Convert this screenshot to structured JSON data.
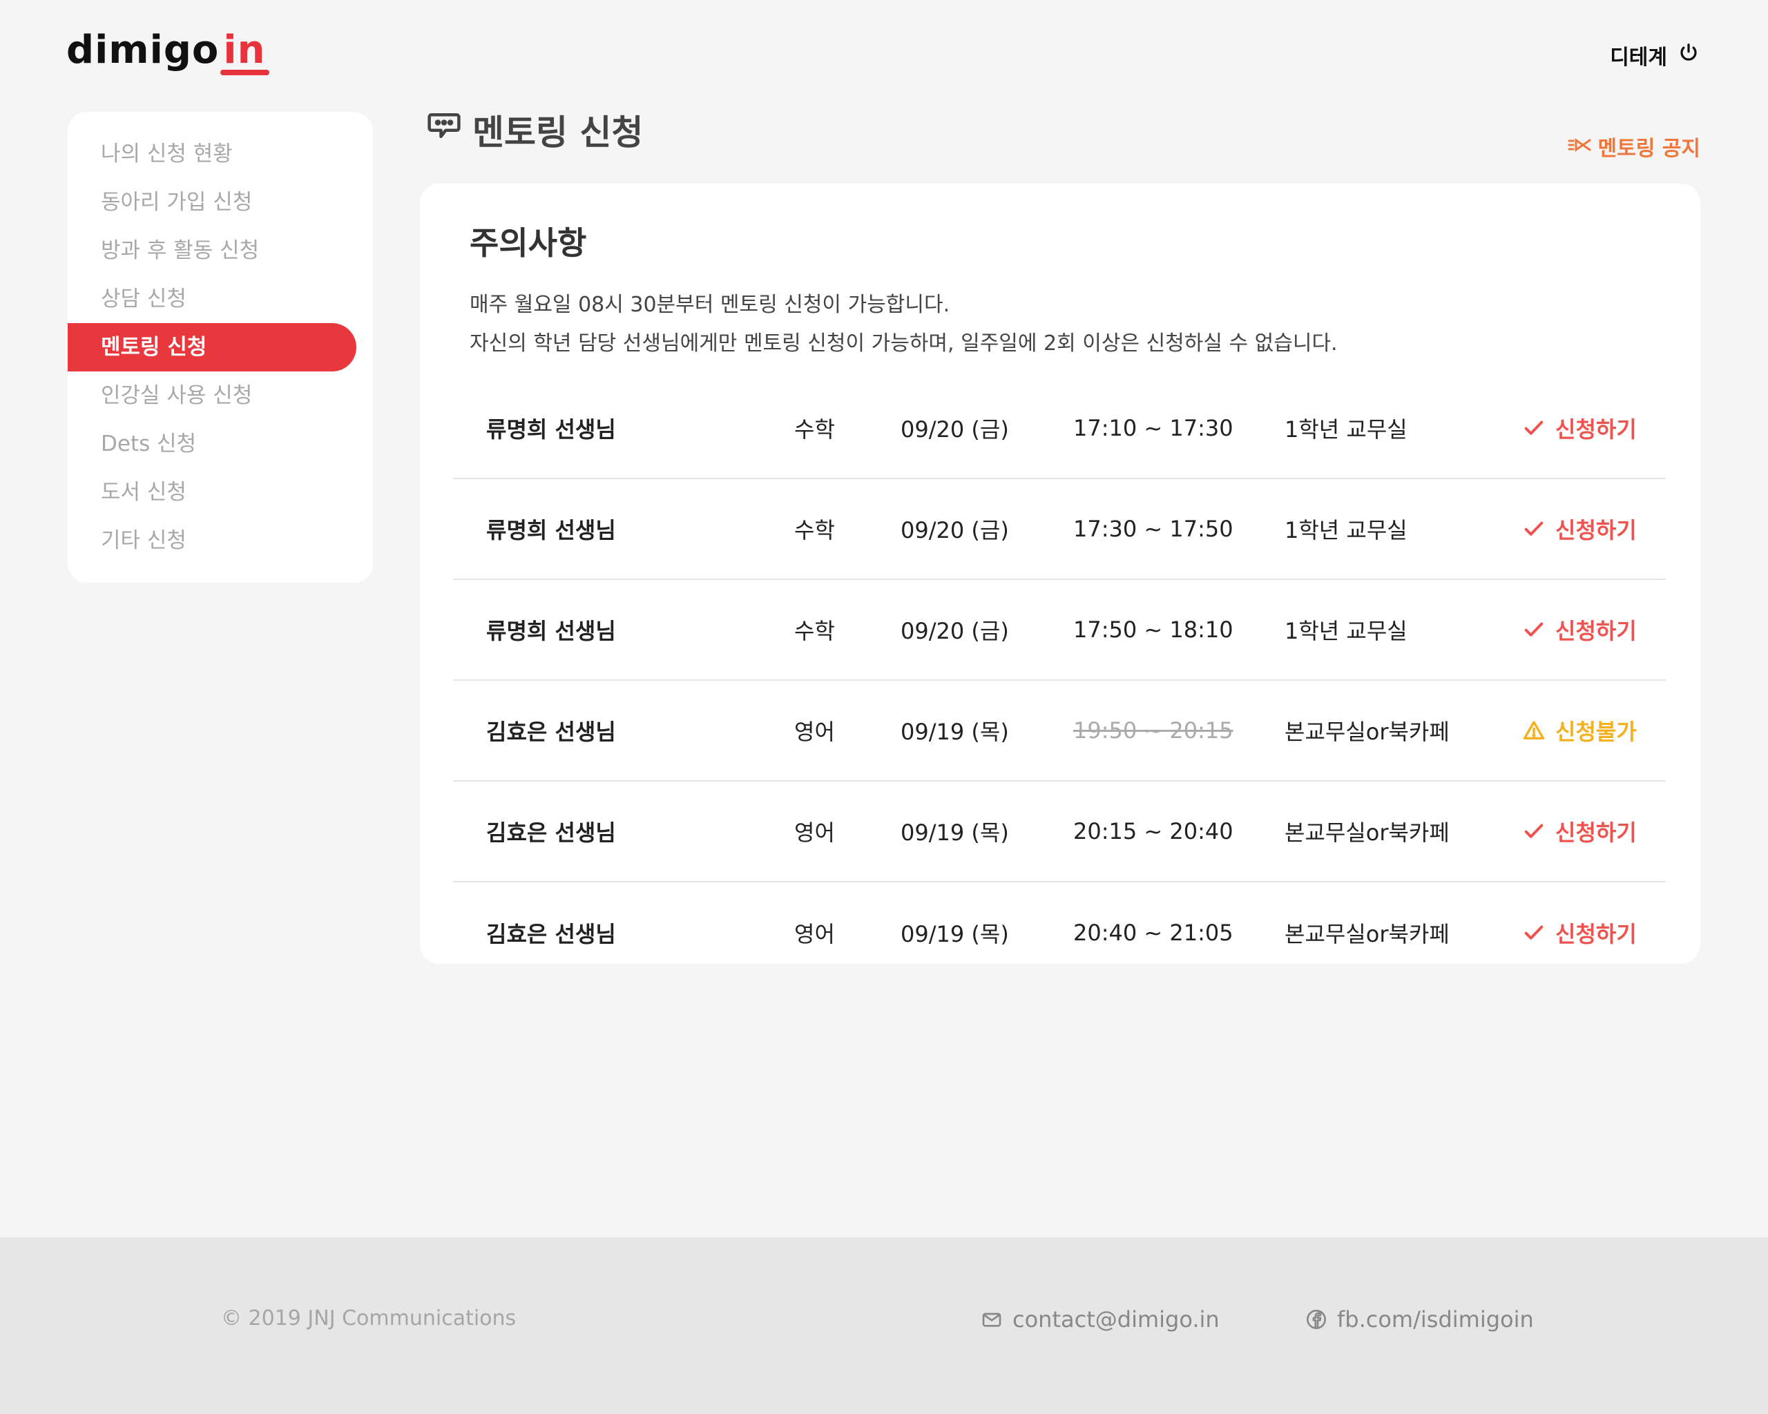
{
  "header": {
    "logo_main": "dimigo",
    "logo_accent": "in",
    "user_name": "디테계"
  },
  "sidebar": {
    "items": [
      {
        "label": "나의 신청 현황"
      },
      {
        "label": "동아리 가입 신청"
      },
      {
        "label": "방과 후 활동 신청"
      },
      {
        "label": "상담 신청"
      },
      {
        "label": "멘토링 신청",
        "active": true
      },
      {
        "label": "인강실 사용 신청"
      },
      {
        "label": "Dets 신청"
      },
      {
        "label": "도서 신청"
      },
      {
        "label": "기타 신청"
      }
    ]
  },
  "main": {
    "title": "멘토링 신청",
    "notice_link": "멘토링 공지",
    "card_title": "주의사항",
    "notes": [
      "매주 월요일 08시 30분부터 멘토링 신청이 가능합니다.",
      "자신의 학년 담당 선생님에게만 멘토링 신청이 가능하며, 일주일에 2회 이상은 신청하실 수 없습니다."
    ],
    "rows": [
      {
        "teacher": "류명희 선생님",
        "subject": "수학",
        "date": "09/20 (금)",
        "time": "17:10 ~ 17:30",
        "room": "1학년 교무실",
        "action": "신청하기",
        "status": "available"
      },
      {
        "teacher": "류명희 선생님",
        "subject": "수학",
        "date": "09/20 (금)",
        "time": "17:30 ~ 17:50",
        "room": "1학년 교무실",
        "action": "신청하기",
        "status": "available"
      },
      {
        "teacher": "류명희 선생님",
        "subject": "수학",
        "date": "09/20 (금)",
        "time": "17:50 ~ 18:10",
        "room": "1학년 교무실",
        "action": "신청하기",
        "status": "available"
      },
      {
        "teacher": "김효은 선생님",
        "subject": "영어",
        "date": "09/19 (목)",
        "time": "19:50 ~ 20:15",
        "room": "본교무실or북카페",
        "action": "신청불가",
        "status": "unavailable"
      },
      {
        "teacher": "김효은 선생님",
        "subject": "영어",
        "date": "09/19 (목)",
        "time": "20:15 ~ 20:40",
        "room": "본교무실or북카페",
        "action": "신청하기",
        "status": "available"
      },
      {
        "teacher": "김효은 선생님",
        "subject": "영어",
        "date": "09/19 (목)",
        "time": "20:40 ~ 21:05",
        "room": "본교무실or북카페",
        "action": "신청하기",
        "status": "available"
      }
    ]
  },
  "footer": {
    "copyright": "© 2019 JNJ Communications",
    "email": "contact@dimigo.in",
    "facebook": "fb.com/isdimigoin"
  },
  "colors": {
    "accent": "#e8383e",
    "action_available": "#ef5350",
    "action_unavailable": "#f5b01e",
    "notice_link": "#f0763a"
  },
  "icons": {
    "user": "power-icon",
    "title": "chat-bubble-icon",
    "notice": "megaphone-icon",
    "available": "check-icon",
    "unavailable": "warning-icon",
    "email": "mail-icon",
    "facebook": "facebook-icon"
  }
}
